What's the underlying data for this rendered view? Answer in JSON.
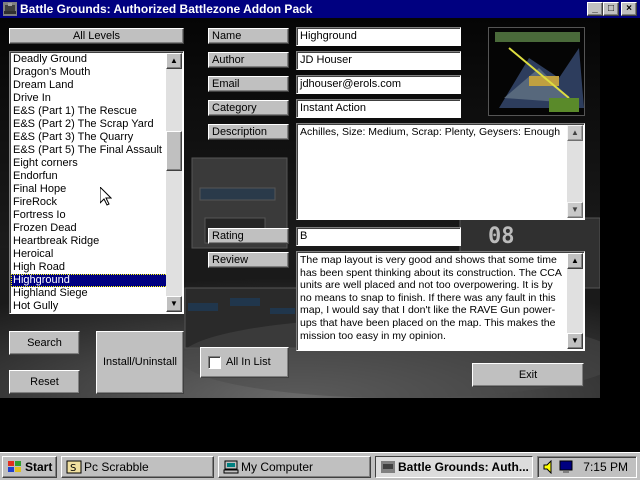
{
  "window": {
    "title": "Battle Grounds: Authorized Battlezone Addon Pack",
    "minimize": "_",
    "maximize": "□",
    "close": "×"
  },
  "list": {
    "header": "All Levels",
    "items": [
      "Deadly Ground",
      "Dragon's Mouth",
      "Dream Land",
      "Drive In",
      "E&S (Part 1) The Rescue",
      "E&S (Part 2) The Scrap Yard",
      "E&S (Part 3) The Quarry",
      "E&S (Part 5) The Final Assault",
      "Eight corners",
      "Endorfun",
      "Final Hope",
      "FireRock",
      "Fortress Io",
      "Frozen Dead",
      "Heartbreak Ridge",
      "Heroical",
      "High Road",
      "Highground",
      "Highland Siege",
      "Hot Gully"
    ],
    "selected_index": 17
  },
  "fields": {
    "name_label": "Name",
    "name_value": "Highground",
    "author_label": "Author",
    "author_value": "JD Houser",
    "email_label": "Email",
    "email_value": "jdhouser@erols.com",
    "category_label": "Category",
    "category_value": "Instant Action",
    "description_label": "Description",
    "description_value": "Achilles, Size: Medium, Scrap: Plenty, Geysers: Enough",
    "rating_label": "Rating",
    "rating_value": "B",
    "review_label": "Review",
    "review_value": "The map layout is very good and shows that some time has been spent thinking about its construction. The CCA units are well placed and not too overpowering. It is by no means to snap to finish. If there was any fault in this map, I would say that I don't like the RAVE Gun power-ups that have been placed on the map. This makes the mission too easy in my opinion."
  },
  "buttons": {
    "search": "Search",
    "reset": "Reset",
    "install": "Install/Uninstall",
    "all_in_list": "All In List",
    "exit": "Exit"
  },
  "taskbar": {
    "start": "Start",
    "tasks": [
      "Pc Scrabble",
      "My Computer",
      "Battle Grounds: Auth..."
    ],
    "clock": "7:15 PM"
  }
}
